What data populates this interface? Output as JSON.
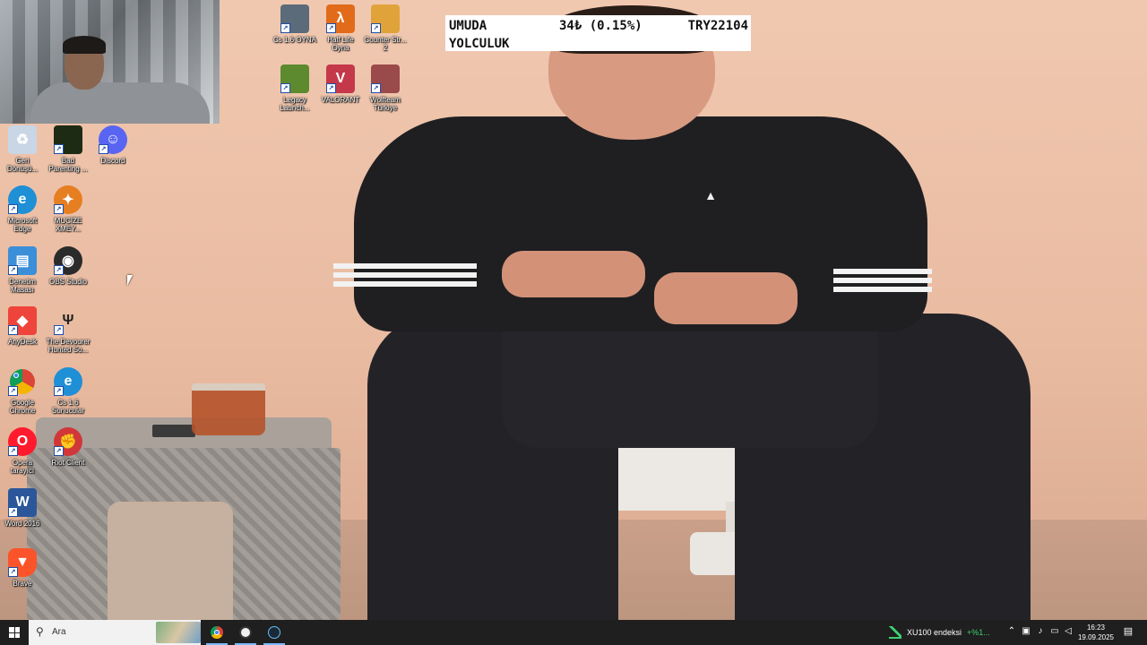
{
  "ticker": {
    "name": "UMUDA YOLCULUK",
    "change": "34₺ (0.15%)",
    "price": "TRY22104"
  },
  "desktop_icons": [
    {
      "label": "Cs 1.6 OYNA",
      "icon": "cs16-icon",
      "color": "#5b6b7a"
    },
    {
      "label": "Half Life Oyna",
      "icon": "half-life-icon",
      "color": "#e26b1a"
    },
    {
      "label": "Counter Str... 2",
      "icon": "cs2-icon",
      "color": "#e0a33a"
    },
    {
      "label": "Legacy Launch...",
      "icon": "minecraft-icon",
      "color": "#5d8a2f"
    },
    {
      "label": "VALORANT",
      "icon": "valorant-icon",
      "color": "#c4384a"
    },
    {
      "label": "Wolfteam Türkiye",
      "icon": "wolfteam-icon",
      "color": "#9a4a4a"
    },
    {
      "label": "Geri Dönüşü...",
      "icon": "recycle-bin-icon",
      "color": "#c8d6e6"
    },
    {
      "label": "Bad Parenting ...",
      "icon": "bad-parenting-icon",
      "color": "#1e2b14"
    },
    {
      "label": "Discord",
      "icon": "discord-icon",
      "color": "#5865f2"
    },
    {
      "label": "Microsoft Edge",
      "icon": "edge-icon",
      "color": "#1f8fd6"
    },
    {
      "label": "MUCİZE XMEY...",
      "icon": "mucize-icon",
      "color": "#e67e22"
    },
    {
      "label": "Denetim Masası",
      "icon": "control-panel-icon",
      "color": "#3b8fd8"
    },
    {
      "label": "OBS Studio",
      "icon": "obs-icon",
      "color": "#2b2b2b"
    },
    {
      "label": "AnyDesk",
      "icon": "anydesk-icon",
      "color": "#ef443b"
    },
    {
      "label": "The Devourer Hunted So...",
      "icon": "devourer-icon",
      "color": "#3a3a3a"
    },
    {
      "label": "Google Chrome",
      "icon": "chrome-icon",
      "color": "#4285f4"
    },
    {
      "label": "Cs 1.6 Sunucular",
      "icon": "cs16-servers-icon",
      "color": "#1f8fd6"
    },
    {
      "label": "Opera tarayıcı",
      "icon": "opera-icon",
      "color": "#ff1b2d"
    },
    {
      "label": "Riot Client",
      "icon": "riot-client-icon",
      "color": "#d13639"
    },
    {
      "label": "Word 2016",
      "icon": "word-icon",
      "color": "#2b579a"
    },
    {
      "label": "Brave",
      "icon": "brave-icon",
      "color": "#fb542b"
    }
  ],
  "taskbar": {
    "search_placeholder": "Ara",
    "apps": [
      {
        "name": "chrome",
        "icon": "chrome-icon"
      },
      {
        "name": "obs",
        "icon": "obs-icon"
      },
      {
        "name": "steam",
        "icon": "steam-icon"
      }
    ],
    "market_label": "XU100 endeksi",
    "market_change": "+%1...",
    "time": "16:23",
    "date": "19.09.2025"
  },
  "colors": {
    "taskbar_bg": "#1f1f1f",
    "market_up": "#3bd16f",
    "ticker_bg": "#ffffff"
  }
}
